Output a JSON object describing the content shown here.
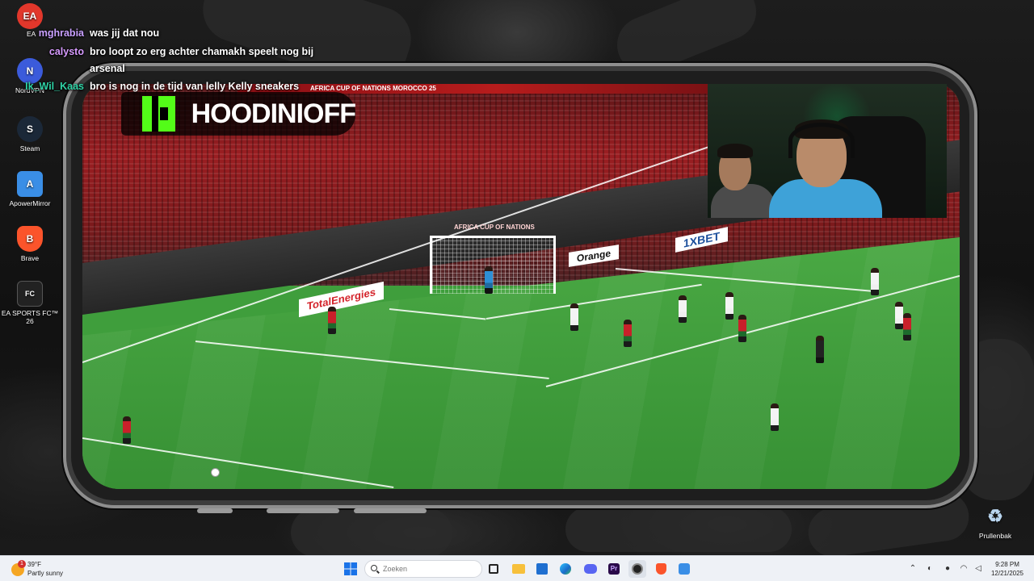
{
  "desktop": {
    "icons": [
      {
        "label": "EA",
        "glyph": "EA",
        "color": "#e2372b",
        "icon": "ea-app-icon"
      },
      {
        "label": "NordVPN",
        "glyph": "N",
        "color": "#3b5bdb",
        "icon": "nordvpn-icon"
      },
      {
        "label": "Steam",
        "glyph": "S",
        "color": "#1b2838",
        "icon": "steam-icon"
      },
      {
        "label": "ApowerMirror",
        "glyph": "A",
        "color": "#3a8ee6",
        "icon": "apowermirror-icon"
      },
      {
        "label": "Brave",
        "glyph": "B",
        "color": "#fb542b",
        "icon": "brave-icon"
      },
      {
        "label": "EA SPORTS FC™ 26",
        "glyph": "FC",
        "color": "#222222",
        "icon": "ea-sports-fc-icon"
      },
      {
        "label": "Prullenbak",
        "glyph": "♻",
        "color": "#8fb6d9",
        "icon": "recycle-bin-icon"
      }
    ]
  },
  "chat": [
    {
      "user": "mghrabia",
      "user_color": "#c9a0ff",
      "text": "was jij dat nou"
    },
    {
      "user": "calysto",
      "user_color": "#d79bff",
      "text": "bro loopt zo erg achter chamakh speelt nog bij"
    },
    {
      "user": "",
      "user_color": "#ffffff",
      "text": "arsenal"
    },
    {
      "user": "Ik_Wil_Kaas",
      "user_color": "#2fd3a6",
      "text": "bro is nog in de tijd van lelly Kelly sneakers"
    }
  ],
  "stream": {
    "platform_icon": "kick-logo-icon",
    "streamer_name": "HOODINIOFF",
    "broadcast_bar": "AFRICA CUP OF NATIONS MOROCCO 25",
    "boards": {
      "totalenergies": "TotalEnergies",
      "orange": "Orange",
      "onexbet": "1XBET",
      "afcon": "AFRICA CUP OF NATIONS"
    }
  },
  "taskbar": {
    "weather": {
      "temp": "39°F",
      "condition": "Partly sunny",
      "alerts": "1"
    },
    "search_placeholder": "Zoeken",
    "apps": [
      "start-icon",
      "task-view-icon",
      "file-explorer-icon",
      "store-icon",
      "edge-icon",
      "discord-icon",
      "premiere-pro-icon",
      "obs-icon",
      "brave-icon",
      "apowermirror-icon"
    ],
    "clock": {
      "time": "9:28 PM",
      "date": "12/21/2025"
    }
  },
  "colors": {
    "kick_green": "#53fc18",
    "taskbar_bg": "#eef1f6",
    "pitch_green": "#3f9e3c",
    "crowd_red": "#9b1e22"
  }
}
